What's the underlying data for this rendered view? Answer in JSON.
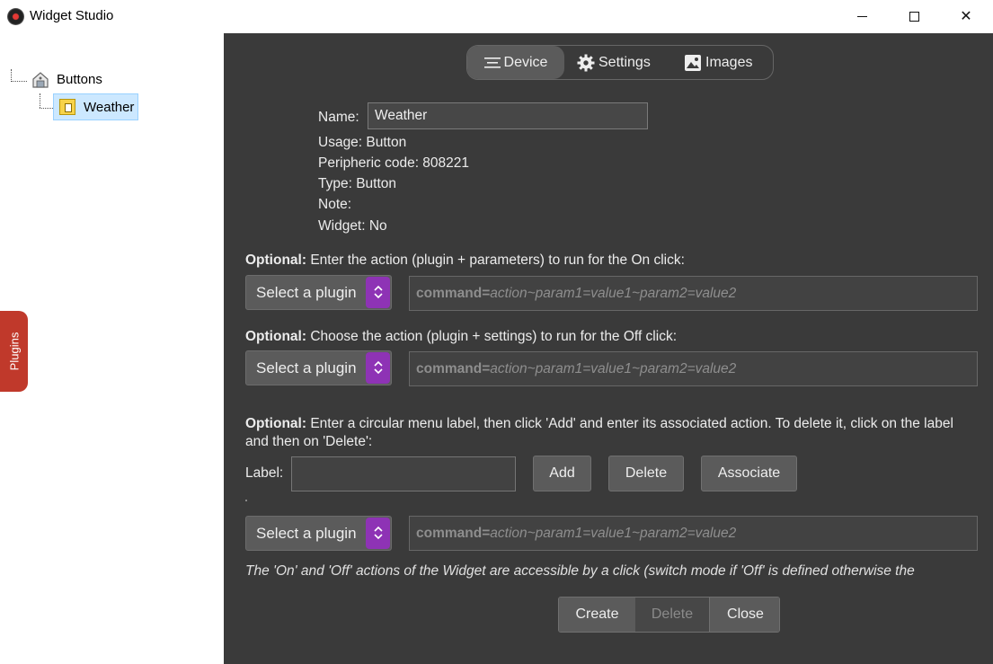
{
  "window": {
    "title": "Widget Studio",
    "minimize_glyph": "minimize",
    "maximize_glyph": "maximize",
    "close_glyph": "✕"
  },
  "tree": {
    "root_label": "Buttons",
    "child_label": "Weather"
  },
  "plugins_tab": {
    "label": "Plugins"
  },
  "tabs": [
    {
      "label": "Device",
      "icon": "hamburger-icon"
    },
    {
      "label": "Settings",
      "icon": "gear-icon"
    },
    {
      "label": "Images",
      "icon": "image-icon"
    }
  ],
  "device": {
    "name_label": "Name:",
    "name_value": "Weather",
    "usage": "Usage: Button",
    "peripheric": "Peripheric code: 808221",
    "type": "Type: Button",
    "note": "Note:",
    "widget": "Widget: No"
  },
  "on_action": {
    "optional": "Optional:",
    "text": " Enter the action (plugin + parameters) to run for the On click:",
    "select_label": "Select a plugin",
    "cmd_keyword": "command=",
    "cmd_placeholder": "action~param1=value1~param2=value2"
  },
  "off_action": {
    "optional": "Optional:",
    "text": " Choose the action (plugin + settings) to run for the Off click:",
    "select_label": "Select a plugin",
    "cmd_keyword": "command=",
    "cmd_placeholder": "action~param1=value1~param2=value2"
  },
  "circular": {
    "optional": "Optional:",
    "text": " Enter a circular menu label, then click 'Add' and enter its associated action. To delete it, click on the label and then on 'Delete':",
    "label": "Label:",
    "add": "Add",
    "delete": "Delete",
    "associate": "Associate",
    "select_label": "Select a plugin",
    "cmd_keyword": "command=",
    "cmd_placeholder": "action~param1=value1~param2=value2"
  },
  "note_text": "The 'On' and 'Off' actions of the Widget are accessible by a click (switch mode if 'Off' is defined otherwise the",
  "footer": {
    "create": "Create",
    "delete": "Delete",
    "close": "Close"
  },
  "colors": {
    "panel": "#3a3a3a",
    "spinner_accent": "#8e33b5",
    "plugins_tab": "#c0392b",
    "tree_selection": "#cce8ff"
  }
}
